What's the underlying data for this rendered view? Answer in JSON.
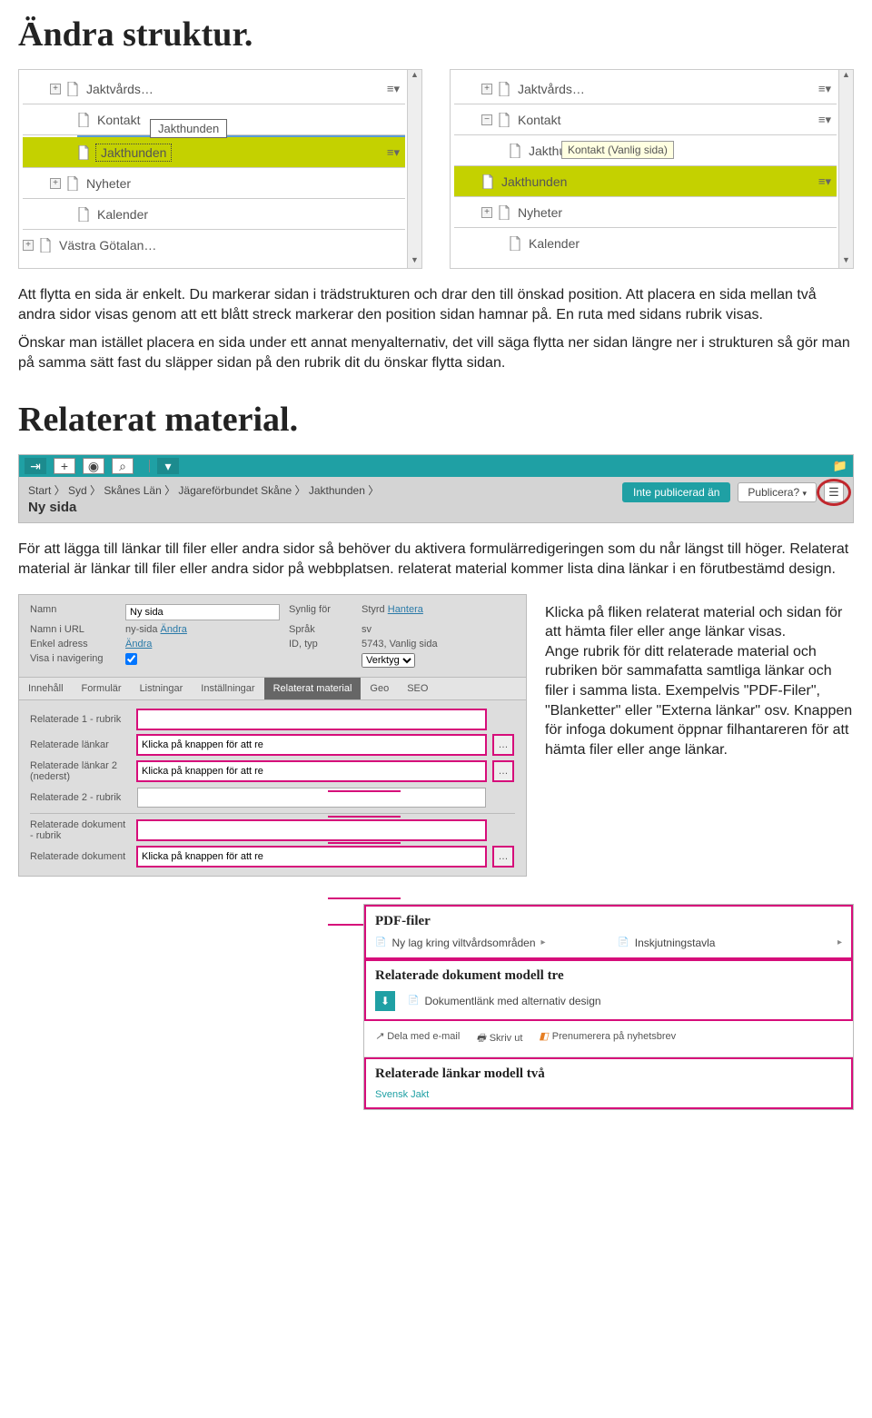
{
  "h1a": "Ändra struktur.",
  "tree_left": {
    "items": [
      {
        "indent": 1,
        "exp": "+",
        "label": "Jaktvårds…",
        "menu": true
      },
      {
        "indent": 2,
        "exp": "",
        "label": "Kontakt"
      },
      {
        "indent": 2,
        "exp": "",
        "label": "Jakthunden",
        "selected": true,
        "dotted": true,
        "menu": true
      },
      {
        "indent": 1,
        "exp": "+",
        "label": "Nyheter"
      },
      {
        "indent": 2,
        "exp": "",
        "label": "Kalender"
      },
      {
        "indent": 0,
        "exp": "+",
        "label": "Västra Götalan…"
      }
    ],
    "float_label": "Jakthunden"
  },
  "tree_right": {
    "items": [
      {
        "indent": 1,
        "exp": "+",
        "label": "Jaktvårds…",
        "menu": true
      },
      {
        "indent": 1,
        "exp": "−",
        "label": "Kontakt",
        "menu": true
      },
      {
        "indent": 2,
        "exp": "",
        "label": "Jakthu"
      },
      {
        "indent": 1,
        "exp": "",
        "label": "Jakthunden",
        "selected": true,
        "menu": true
      },
      {
        "indent": 1,
        "exp": "+",
        "label": "Nyheter"
      },
      {
        "indent": 2,
        "exp": "",
        "label": "Kalender"
      }
    ],
    "tooltip": "Kontakt (Vanlig sida)"
  },
  "p1": "Att flytta en sida är enkelt. Du markerar sidan i trädstrukturen och drar den till önskad position. Att placera en sida mellan två andra sidor visas genom att ett blått streck markerar den position sidan hamnar på. En ruta med sidans rubrik visas.",
  "p2": "Önskar man istället placera en sida under ett annat menyalternativ, det vill säga flytta ner sidan längre ner i strukturen så gör man på samma sätt fast du släpper sidan på den rubrik dit du önskar flytta sidan.",
  "h1b": "Relaterat material.",
  "toolbar": {
    "breadcrumb": "Start 〉 Syd 〉 Skånes Län 〉 Jägareförbundet Skåne 〉 Jakthunden 〉",
    "title": "Ny sida",
    "status": "Inte publicerad än",
    "action": "Publicera?"
  },
  "p3": "För att lägga till länkar till filer eller andra sidor så behöver du aktivera formulärredigeringen som du når längst till höger. Relaterat material är länkar till filer eller andra sidor på webbplatsen. relaterat material kommer lista dina länkar i en förutbestämd design.",
  "form": {
    "labels": {
      "namn": "Namn",
      "url": "Namn i URL",
      "enkel": "Enkel adress",
      "visa": "Visa i navigering",
      "synlig": "Synlig för",
      "sprak": "Språk",
      "idtyp": "ID, typ",
      "styrd": "Styrd"
    },
    "values": {
      "namn": "Ny sida",
      "url": "ny-sida",
      "sprak": "sv",
      "idtyp": "5743, Vanlig sida",
      "verktyg": "Verktyg"
    },
    "links": {
      "andra": "Ändra",
      "hantera": "Hantera"
    },
    "tabs": [
      "Innehåll",
      "Formulär",
      "Listningar",
      "Inställningar",
      "Relaterat material",
      "Geo",
      "SEO"
    ],
    "active_tab": "Relaterat material",
    "rel": {
      "r1": "Relaterade 1 - rubrik",
      "r2": "Relaterade länkar",
      "r3": "Relaterade länkar 2 (nederst)",
      "r4": "Relaterade 2 - rubrik",
      "r5": "Relaterade dokument - rubrik",
      "r6": "Relaterade dokument",
      "placeholder": "Klicka på knappen för att re"
    }
  },
  "side_p": "Klicka på fliken relaterat material och sidan för att hämta filer eller ange länkar visas.\nAnge rubrik för ditt relaterade material och rubriken bör sammafatta samtliga länkar och filer i samma lista. Exempelvis \"PDF-Filer\", \"Blanketter\" eller \"Externa länkar\" osv. Knappen för infoga dokument öppnar filhantareren för att hämta filer eller ange länkar.",
  "preview": {
    "s1_title": "PDF-filer",
    "s1_i1": "Ny lag kring viltvårdsområden",
    "s1_i2": "Inskjutningstavla",
    "s2_title": "Relaterade dokument modell tre",
    "s2_i1": "Dokumentlänk med alternativ design",
    "f1": "Dela med e-mail",
    "f2": "Skriv ut",
    "f3": "Prenumerera på nyhetsbrev",
    "s3_title": "Relaterade länkar modell två",
    "s3_i1": "Svensk Jakt"
  }
}
